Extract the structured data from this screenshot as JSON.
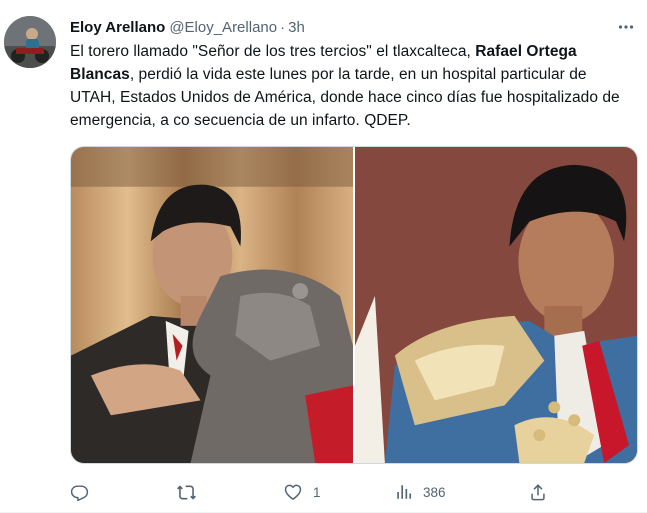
{
  "tweet": {
    "author_name": "Eloy Arellano",
    "author_handle": "@Eloy_Arellano",
    "separator": "·",
    "time": "3h",
    "text_part1": "El torero llamado \"Señor de los tres tercios\" el tlaxcalteca, ",
    "text_bold": "Rafael Ortega Blancas",
    "text_part2": ", perdió la vida este lunes por la tarde, en un hospital particular de UTAH, Estados Unidos de América, donde hace cinco días fue hospitalizado de emergencia, a co secuencia de un infarto.  QDEP."
  },
  "actions": {
    "reply": {
      "icon": "reply-icon",
      "count": ""
    },
    "retweet": {
      "icon": "retweet-icon",
      "count": ""
    },
    "like": {
      "icon": "heart-icon",
      "count": "1"
    },
    "views": {
      "icon": "views-icon",
      "count": "386"
    },
    "share": {
      "icon": "share-icon"
    }
  },
  "colors": {
    "text": "#0f1419",
    "secondary": "#536471",
    "border": "#cfd9de"
  }
}
